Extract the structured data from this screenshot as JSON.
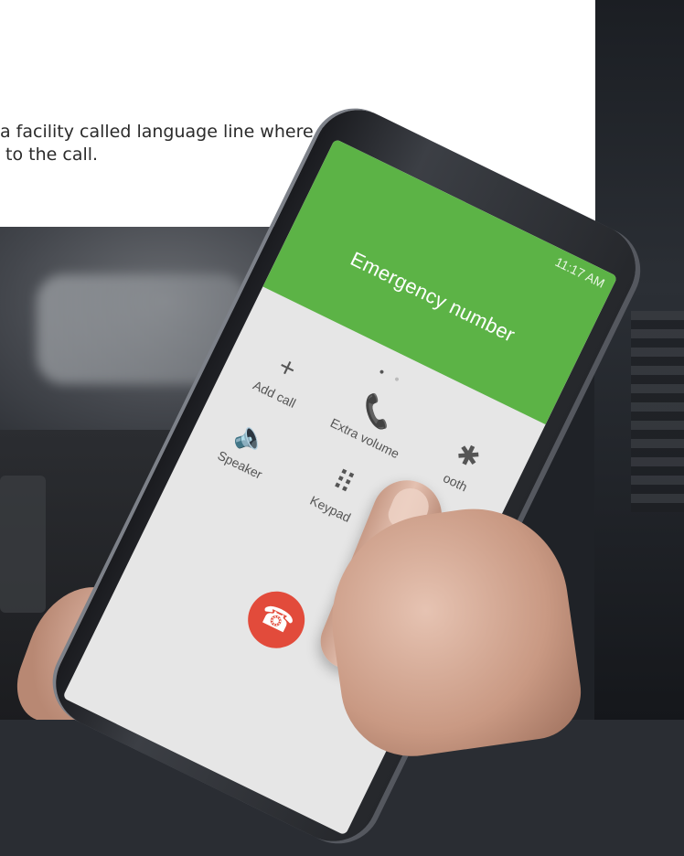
{
  "card": {
    "text": "a facility called language line where a speaker\n to the call."
  },
  "phone": {
    "status_time": "11:17 AM",
    "caller_name": "Emergency number",
    "page_dots": [
      "•",
      "•"
    ],
    "controls": [
      {
        "label": "Add call",
        "icon": "plus-icon",
        "glyph": "+"
      },
      {
        "label": "Extra volume",
        "icon": "phone-volume-icon",
        "glyph": "📞"
      },
      {
        "label": "ooth",
        "icon": "bluetooth-icon",
        "glyph": "✱"
      },
      {
        "label": "Speaker",
        "icon": "speaker-icon",
        "glyph": "🔈"
      },
      {
        "label": "Keypad",
        "icon": "keypad-icon",
        "glyph": "⠿"
      },
      {
        "label": "",
        "icon": "blank",
        "glyph": ""
      }
    ],
    "end_call_icon": "end-call-icon",
    "end_call_color": "#e24b3b",
    "accent_color": "#5cb346"
  }
}
